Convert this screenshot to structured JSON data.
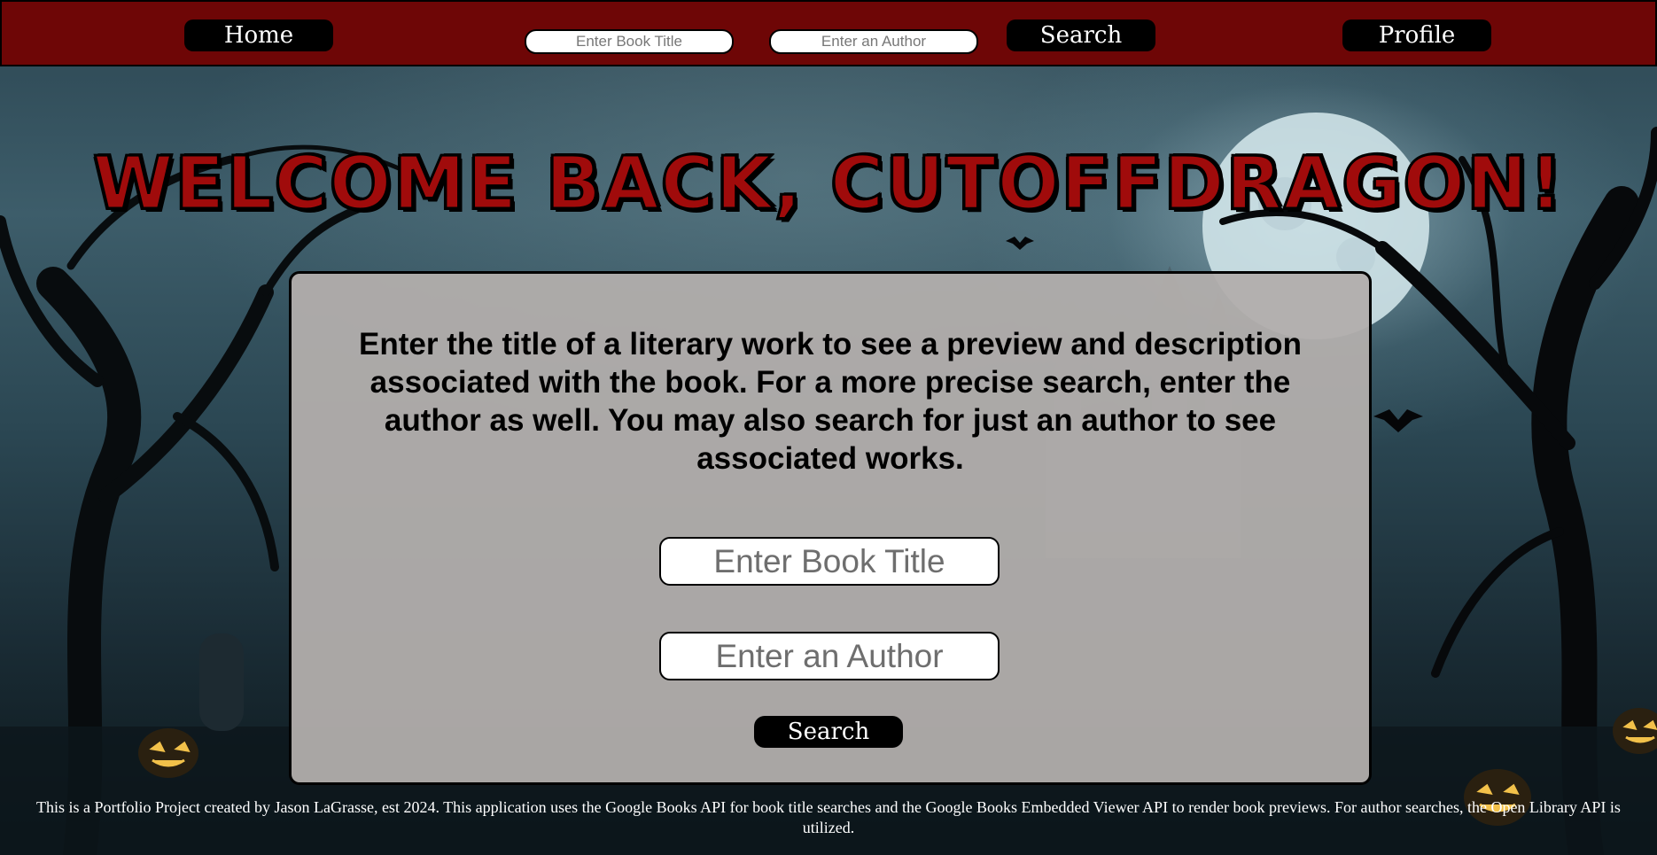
{
  "nav": {
    "home_label": "Home",
    "title_placeholder": "Enter Book Title",
    "author_placeholder": "Enter an Author",
    "search_label": "Search",
    "profile_label": "Profile"
  },
  "welcome": {
    "heading": "Welcome back, cutoffdragon!"
  },
  "panel": {
    "intro_text": "Enter the title of a literary work to see a preview and description associated with the book. For a more precise search, enter the author as well. You may also search for just an author to see associated works.",
    "title_placeholder": "Enter Book Title",
    "author_placeholder": "Enter an Author",
    "search_label": "Search"
  },
  "footer": {
    "text": "This is a Portfolio Project created by Jason LaGrasse, est 2024. This application uses the Google Books API for book title searches and the Google Books Embedded Viewer API to render book previews. For author searches, the Open Library API is utilized."
  },
  "colors": {
    "navbar": "#6e0606",
    "heading": "#a00b0b",
    "panel": "#b2aeac",
    "button": "#000000"
  },
  "background": {
    "scene_icon": "haunted-castle-graveyard"
  }
}
